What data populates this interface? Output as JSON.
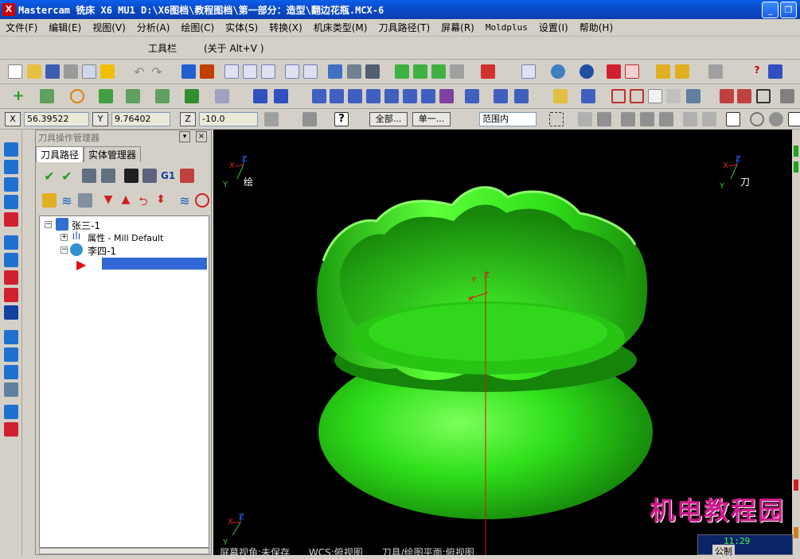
{
  "window": {
    "title": "Mastercam 铣床 X6 MU1  D:\\X6图档\\教程图档\\第一部分：造型\\翻边花瓶.MCX-6"
  },
  "menu": [
    "文件(F)",
    "编辑(E)",
    "视图(V)",
    "分析(A)",
    "绘图(C)",
    "实体(S)",
    "转换(X)",
    "机床类型(M)",
    "刀具路径(T)",
    "屏幕(R)",
    "Moldplus",
    "设置(I)",
    "帮助(H)"
  ],
  "toolbar": {
    "label": "工具栏",
    "hint": "(关于 Alt+V )"
  },
  "coords": {
    "x_label": "X",
    "x_value": "56.39522",
    "y_label": "Y",
    "y_value": "9.76402",
    "z_label": "Z",
    "z_value": "-10.0",
    "all_button": "全部...",
    "single_button": "单一...",
    "range_select": "范围内"
  },
  "panel": {
    "title": "刀具操作管理器",
    "tabs": [
      "刀具路径",
      "实体管理器"
    ],
    "tree": {
      "root": "张三-1",
      "properties": "属性 - Mill Default",
      "child": "李四-1"
    }
  },
  "viewport": {
    "gview_label": "绘",
    "tplane_label": "刀",
    "axis_x": "X",
    "axis_y": "Y",
    "axis_z": "Z",
    "model_color": "#22dd10"
  },
  "status": {
    "screen_view": "屏幕视角:未保存",
    "wcs": "WCS:俯视图",
    "tool_plane": "刀具/绘图平面:俯视图"
  },
  "watermark": "机电教程园",
  "clock": "11:29",
  "clock_sub": "公制"
}
